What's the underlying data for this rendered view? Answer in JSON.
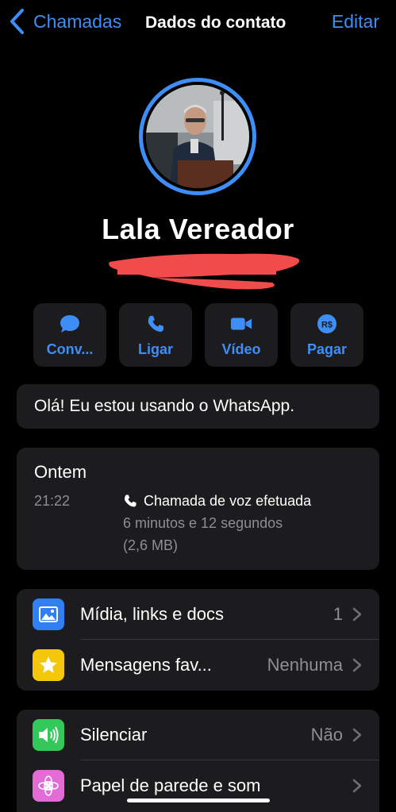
{
  "nav": {
    "back_label": "Chamadas",
    "title": "Dados do contato",
    "edit_label": "Editar"
  },
  "contact": {
    "name": "Lala Vereador"
  },
  "actions": [
    {
      "label": "Conv...",
      "icon": "message-bubble-icon"
    },
    {
      "label": "Ligar",
      "icon": "phone-icon"
    },
    {
      "label": "Vídeo",
      "icon": "video-camera-icon"
    },
    {
      "label": "Pagar",
      "icon": "payment-real-icon"
    }
  ],
  "status": {
    "text": "Olá! Eu estou usando o WhatsApp."
  },
  "calls": {
    "day": "Ontem",
    "time": "21:22",
    "type": "Chamada de voz efetuada",
    "duration": "6 minutos e 12 segundos",
    "size": "(2,6 MB)"
  },
  "media_section": [
    {
      "label": "Mídia, links e docs",
      "value": "1",
      "icon": "photo-icon",
      "color": "#2f7ff5"
    },
    {
      "label": "Mensagens fav...",
      "value": "Nenhuma",
      "icon": "star-icon",
      "color": "#f5c70b"
    }
  ],
  "settings_section": [
    {
      "label": "Silenciar",
      "value": "Não",
      "icon": "speaker-icon",
      "color": "#34c759"
    },
    {
      "label": "Papel de parede e som",
      "value": "",
      "icon": "flower-icon",
      "color": "#e26bd6"
    }
  ],
  "colors": {
    "accent": "#3d8ef7",
    "background": "#000000",
    "card": "#1c1c1e",
    "redaction": "#f04c4c"
  }
}
